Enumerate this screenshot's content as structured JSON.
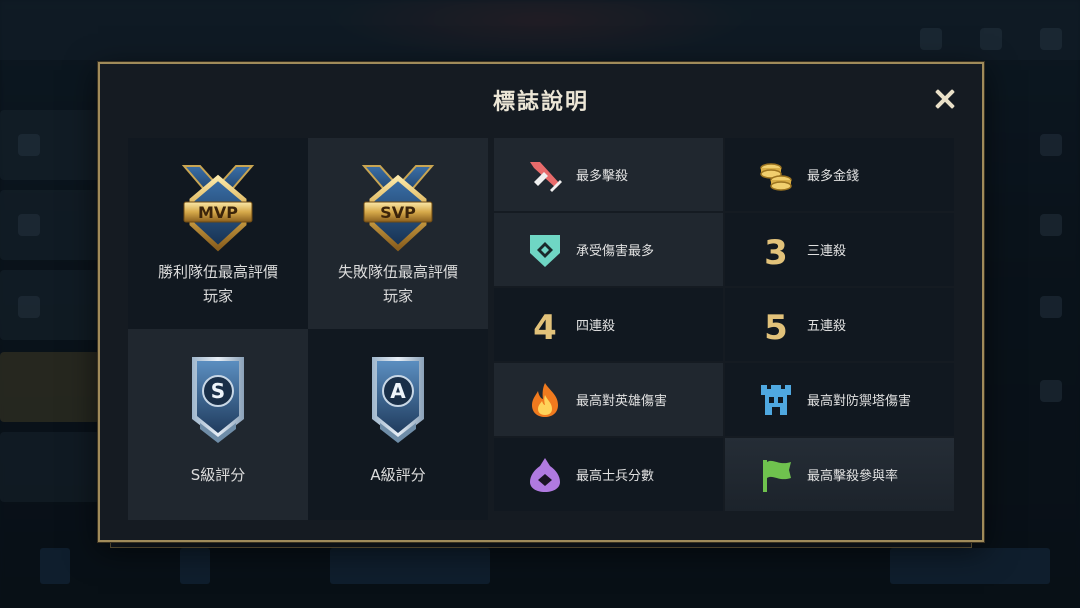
{
  "dialog": {
    "title": "標誌說明",
    "close_label": "✕"
  },
  "grades": [
    {
      "id": "mvp",
      "badge_text": "MVP",
      "label": "勝利隊伍最高評價玩家"
    },
    {
      "id": "svp",
      "badge_text": "SVP",
      "label": "失敗隊伍最高評價玩家"
    },
    {
      "id": "s",
      "badge_text": "S",
      "label": "S級評分"
    },
    {
      "id": "a",
      "badge_text": "A",
      "label": "A級評分"
    }
  ],
  "marks": [
    {
      "icon": "sword-icon",
      "label": "最多擊殺"
    },
    {
      "icon": "coins-icon",
      "label": "最多金錢"
    },
    {
      "icon": "shield-icon",
      "label": "承受傷害最多"
    },
    {
      "icon": "triple-kill-icon",
      "glyph": "3",
      "label": "三連殺"
    },
    {
      "icon": "quadra-kill-icon",
      "glyph": "4",
      "label": "四連殺"
    },
    {
      "icon": "penta-kill-icon",
      "glyph": "5",
      "label": "五連殺"
    },
    {
      "icon": "flame-icon",
      "label": "最高對英雄傷害"
    },
    {
      "icon": "tower-icon",
      "label": "最高對防禦塔傷害"
    },
    {
      "icon": "minion-icon",
      "label": "最高士兵分數"
    },
    {
      "icon": "flag-icon",
      "label": "最高擊殺參與率"
    }
  ],
  "colors": {
    "border": "#a08b5a",
    "gold": "#d8b55a",
    "cyan": "#5cc9b8",
    "rank_blue": "#4d7fb2"
  }
}
